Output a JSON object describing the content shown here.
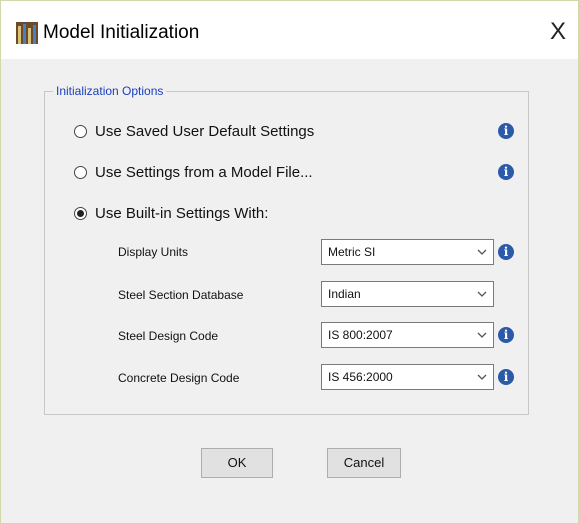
{
  "window": {
    "title": "Model Initialization",
    "close_glyph": "X"
  },
  "group": {
    "label": "Initialization Options"
  },
  "options": [
    {
      "label": "Use Saved User Default Settings",
      "selected": false
    },
    {
      "label": "Use Settings from a Model File...",
      "selected": false
    },
    {
      "label": "Use Built-in Settings With:",
      "selected": true
    }
  ],
  "info_glyph": "i",
  "settings": [
    {
      "label": "Display Units",
      "value": "Metric SI",
      "has_info": true
    },
    {
      "label": "Steel Section Database",
      "value": "Indian",
      "has_info": false
    },
    {
      "label": "Steel Design Code",
      "value": "IS 800:2007",
      "has_info": true
    },
    {
      "label": "Concrete Design Code",
      "value": "IS 456:2000",
      "has_info": true
    }
  ],
  "buttons": {
    "ok": "OK",
    "cancel": "Cancel"
  },
  "colors": {
    "info": "#2b5aa8",
    "group_label": "#1a3fbf"
  }
}
